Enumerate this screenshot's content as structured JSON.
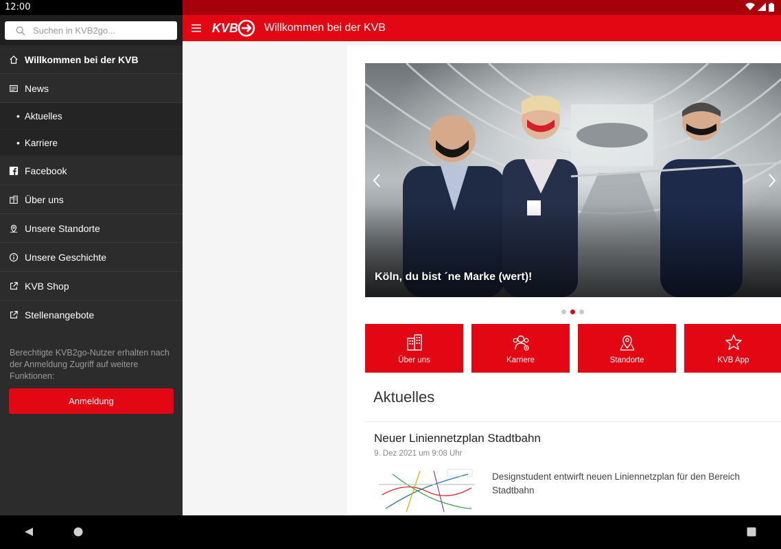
{
  "status": {
    "time": "12:00"
  },
  "search": {
    "placeholder": "Suchen in KVB2go..."
  },
  "sidebar": {
    "items": [
      {
        "label": "Willkommen bei der KVB",
        "icon": "home-icon"
      },
      {
        "label": "News",
        "icon": "newspaper-icon"
      },
      {
        "label": "Aktuelles",
        "icon": "bullet"
      },
      {
        "label": "Karriere",
        "icon": "bullet"
      },
      {
        "label": "Facebook",
        "icon": "facebook-icon"
      },
      {
        "label": "Über uns",
        "icon": "building-icon"
      },
      {
        "label": "Unsere Standorte",
        "icon": "location-icon"
      },
      {
        "label": "Unsere Geschichte",
        "icon": "info-icon"
      },
      {
        "label": "KVB Shop",
        "icon": "external-link-icon"
      },
      {
        "label": "Stellenangebote",
        "icon": "external-link-icon"
      }
    ],
    "info_text": "Berechtigte KVB2go-Nutzer erhalten nach der Anmeldung Zugriff auf weitere Funktionen:",
    "login_label": "Anmeldung"
  },
  "appbar": {
    "logo_text": "KVB",
    "title": "Willkommen bei der KVB"
  },
  "carousel": {
    "caption": "Köln, du bist ´ne Marke (wert)!",
    "page_index": 1,
    "page_count": 3
  },
  "tiles": [
    {
      "label": "Über uns",
      "icon": "building-icon"
    },
    {
      "label": "Karriere",
      "icon": "people-icon"
    },
    {
      "label": "Standorte",
      "icon": "map-pin-icon"
    },
    {
      "label": "KVB App",
      "icon": "star-icon"
    }
  ],
  "section": {
    "title": "Aktuelles"
  },
  "news": {
    "title": "Neuer Liniennetzplan Stadtbahn",
    "date": "9. Dez 2021 um 9:08 Uhr",
    "teaser": "Designstudent entwirft neuen Liniennetzplan für den Bereich Stadtbahn"
  },
  "colors": {
    "brand_red": "#e30613",
    "status_dark_red": "#a7000d",
    "sidebar_bg": "#2c2c2c"
  }
}
